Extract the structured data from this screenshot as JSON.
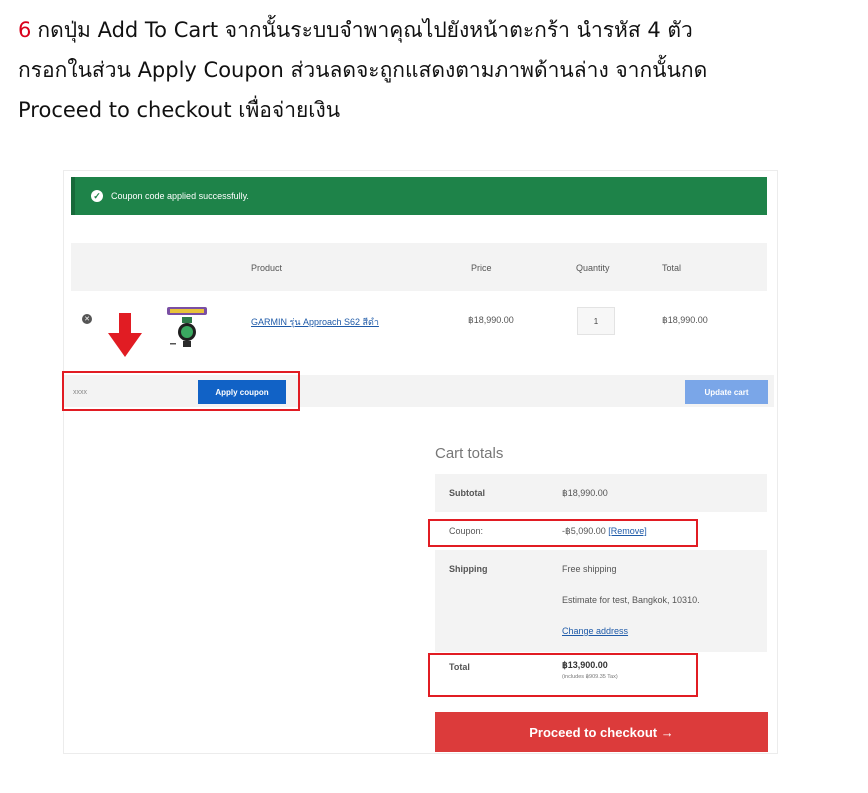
{
  "instructions": {
    "step_number": "6",
    "line1": "กดปุ่ม Add To Cart จากนั้นระบบจำพาคุณไปยังหน้าตะกร้า นำรหัส 4 ตัว",
    "line2": "กรอกในส่วน Apply Coupon ส่วนลดจะถูกแสดงตามภาพด้านล่าง จากนั้นกด",
    "line3": "Proceed to checkout เพื่อจ่ายเงิน"
  },
  "notice": {
    "message": "Coupon code applied successfully."
  },
  "table": {
    "headers": {
      "product": "Product",
      "price": "Price",
      "quantity": "Quantity",
      "total": "Total"
    },
    "items": [
      {
        "name": "GARMIN รุ่น Approach S62 สีดำ",
        "price": "฿18,990.00",
        "quantity": "1",
        "total": "฿18,990.00"
      }
    ]
  },
  "coupon": {
    "code_value": "xxxx",
    "apply_label": "Apply coupon",
    "update_label": "Update cart"
  },
  "totals": {
    "title": "Cart totals",
    "subtotal_label": "Subtotal",
    "subtotal_value": "฿18,990.00",
    "coupon_label": "Coupon:",
    "coupon_value": "-฿5,090.00",
    "coupon_remove": "[Remove]",
    "shipping_label": "Shipping",
    "shipping_value": "Free shipping",
    "shipping_estimate": "Estimate for test, Bangkok, 10310.",
    "change_address": "Change address",
    "total_label": "Total",
    "total_value": "฿13,900.00",
    "total_tax_note": "(includes ฿909.35 Tax)"
  },
  "checkout": {
    "label": "Proceed to checkout →"
  },
  "colors": {
    "notice_green": "#1e8349",
    "apply_blue": "#1162c6",
    "checkout_red": "#dc3b3b",
    "highlight_red": "#e11c23"
  }
}
